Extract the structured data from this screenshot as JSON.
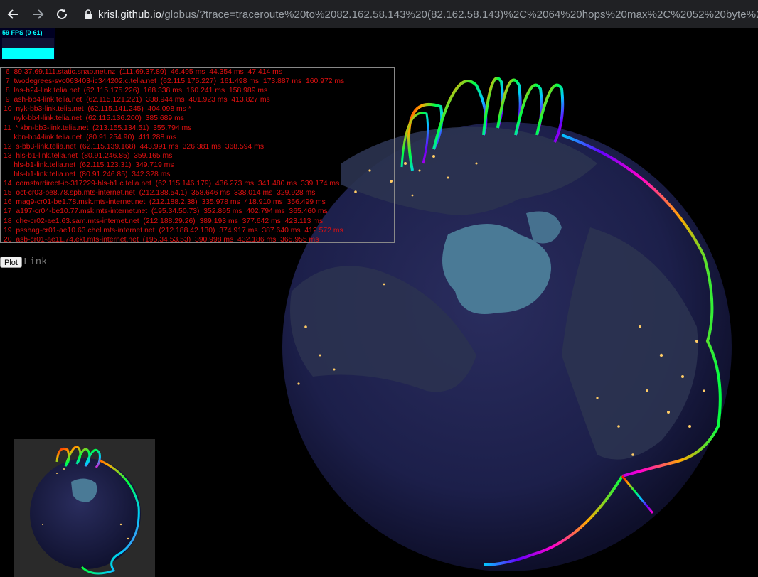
{
  "browser": {
    "back_icon": "arrow-left-icon",
    "forward_icon": "arrow-right-icon",
    "reload_icon": "reload-icon",
    "lock_icon": "lock-icon",
    "url_host": "krisl.github.io",
    "url_rest": "/globus/?trace=traceroute%20to%2082.162.58.143%20(82.162.58.143)%2C%2064%20hops%20max%2C%2052%20byte%20p"
  },
  "fps": {
    "label": "59 FPS (0-61)"
  },
  "trace": {
    "lines": [
      " 6  89.37.69.111.static.snap.net.nz  (111.69.37.89)  46.495 ms  44.354 ms  47.414 ms",
      " 7  twodegrees-svc063403-ic344202.c.telia.net  (62.115.175.227)  161.498 ms  173.887 ms  160.972 ms",
      " 8  las-b24-link.telia.net  (62.115.175.226)  168.338 ms  160.241 ms  158.989 ms",
      " 9  ash-bb4-link.telia.net  (62.115.121.221)  338.944 ms  401.923 ms  413.827 ms",
      "10  nyk-bb3-link.telia.net  (62.115.141.245)  404.098 ms *",
      "     nyk-bb4-link.telia.net  (62.115.136.200)  385.689 ms",
      "11  * kbn-bb3-link.telia.net  (213.155.134.51)  355.794 ms",
      "     kbn-bb4-link.telia.net  (80.91.254.90)  411.288 ms",
      "12  s-bb3-link.telia.net  (62.115.139.168)  443.991 ms  326.381 ms  368.594 ms",
      "13  hls-b1-link.telia.net  (80.91.246.85)  359.165 ms",
      "     hls-b1-link.telia.net  (62.115.123.31)  349.719 ms",
      "     hls-b1-link.telia.net  (80.91.246.85)  342.328 ms",
      "14  comstardirect-ic-317229-hls-b1.c.telia.net  (62.115.146.179)  436.273 ms  341.480 ms  339.174 ms",
      "15  oct-cr03-be8.78.spb.mts-internet.net  (212.188.54.1)  358.646 ms  338.014 ms  329.928 ms",
      "16  mag9-cr01-be1.78.msk.mts-internet.net  (212.188.2.38)  335.978 ms  418.910 ms  356.499 ms",
      "17  a197-cr04-be10.77.msk.mts-internet.net  (195.34.50.73)  352.865 ms  402.794 ms  365.460 ms",
      "18  che-cr02-ae1.63.sam.mts-internet.net  (212.188.29.26)  389.193 ms  377.642 ms  423.113 ms",
      "19  psshag-cr01-ae10.63.chel.mts-internet.net  (212.188.42.130)  374.917 ms  387.640 ms  412.572 ms",
      "20  asb-cr01-ae11.74.ekt.mts-internet.net  (195.34.53.53)  390.998 ms  432.186 ms  365.955 ms"
    ]
  },
  "controls": {
    "plot_label": "Plot",
    "link_label": "Link"
  },
  "colors": {
    "trace_text": "#e01010",
    "globe_ocean": "#1c1f4a",
    "city_lights": "#ffcc66",
    "ice": "#4a7a96"
  }
}
